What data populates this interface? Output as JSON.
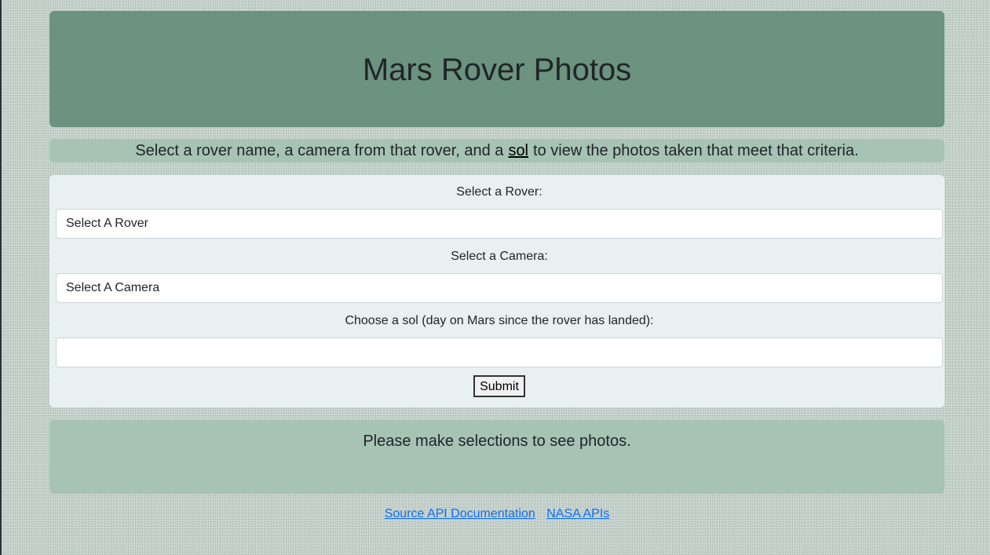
{
  "header": {
    "title": "Mars Rover Photos"
  },
  "intro": {
    "text_before": "Select a rover name, a camera from that rover, and a",
    "link_text": "sol",
    "text_after": "to view the photos taken that meet that criteria."
  },
  "form": {
    "rover_label": "Select a Rover:",
    "rover_selected": "Select A Rover",
    "camera_label": "Select a Camera:",
    "camera_selected": "Select A Camera",
    "sol_label": "Choose a sol (day on Mars since the rover has landed):",
    "sol_value": "",
    "submit_label": "Submit"
  },
  "result": {
    "message": "Please make selections to see photos."
  },
  "footer": {
    "links": [
      {
        "label": "Source API Documentation"
      },
      {
        "label": "NASA APIs"
      }
    ]
  },
  "colors": {
    "header_bg": "#6c9280",
    "panel_bg": "#a6c3b4",
    "form_bg": "#e8f0f1",
    "link": "#0d6efd"
  }
}
